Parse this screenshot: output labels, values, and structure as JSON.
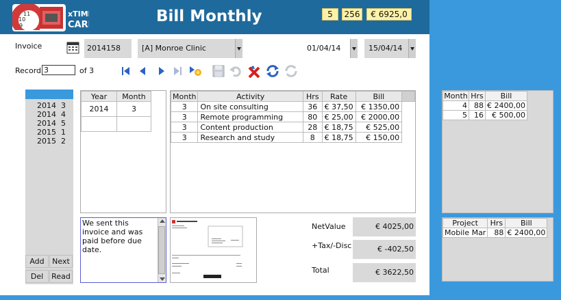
{
  "header": {
    "logo_text_top": "xTIME",
    "logo_text_bottom": "CARD",
    "title": "Bill Monthly",
    "box1": "5",
    "box2": "256",
    "box3": "€ 6925,0"
  },
  "invoice": {
    "label": "Invoice",
    "number": "2014158",
    "client": "[A] Monroe Clinic",
    "date_from": "01/04/14",
    "date_to": "15/04/14"
  },
  "record": {
    "label": "Record",
    "value": "3",
    "of_text": "of 3"
  },
  "left_list": {
    "items": [
      "2014  3",
      "2014  4",
      "2014  5",
      "2015  1",
      "2015  2"
    ],
    "buttons": {
      "add": "Add",
      "next": "Next",
      "del": "Del",
      "read": "Read"
    }
  },
  "year_month": {
    "headers": [
      "Year",
      "Month"
    ],
    "rows": [
      [
        "2014",
        "3"
      ]
    ]
  },
  "activities": {
    "headers": [
      "Month",
      "Activity",
      "Hrs",
      "Rate",
      "Bill"
    ],
    "rows": [
      [
        "3",
        "On site consulting",
        "36",
        "€ 37,50",
        "€ 1350,00"
      ],
      [
        "3",
        "Remote programming",
        "80",
        "€ 25,00",
        "€ 2000,00"
      ],
      [
        "3",
        "Content production",
        "28",
        "€ 18,75",
        "€ 525,00"
      ],
      [
        "3",
        "Research and study",
        "8",
        "€ 18,75",
        "€ 150,00"
      ]
    ]
  },
  "note": {
    "text": "We sent this invoice and was paid before due date."
  },
  "totals": {
    "net_label": "NetValue",
    "net_value": "€ 4025,00",
    "tax_label": "+Tax/-Disc",
    "tax_value": "€ -402,50",
    "total_label": "Total",
    "total_value": "€ 3622,50"
  },
  "right_top": {
    "headers": [
      "Month",
      "Hrs",
      "Bill"
    ],
    "rows": [
      [
        "4",
        "88",
        "€ 2400,00"
      ],
      [
        "5",
        "16",
        "€ 500,00"
      ]
    ]
  },
  "right_bottom": {
    "headers": [
      "Project",
      "Hrs",
      "Bill"
    ],
    "rows": [
      [
        "Mobile Mar",
        "88",
        "€ 2400,00"
      ]
    ]
  },
  "colors": {
    "background": "#3a99dd",
    "header": "#1f6a9c",
    "highlight_box": "#fff2a8",
    "field_gray": "#d9d9d9"
  },
  "icons": [
    "calendar-icon",
    "first-record-icon",
    "prev-record-icon",
    "next-record-icon",
    "last-record-icon",
    "new-record-icon",
    "save-icon",
    "undo-icon",
    "delete-icon",
    "refresh-icon",
    "print-icon"
  ]
}
